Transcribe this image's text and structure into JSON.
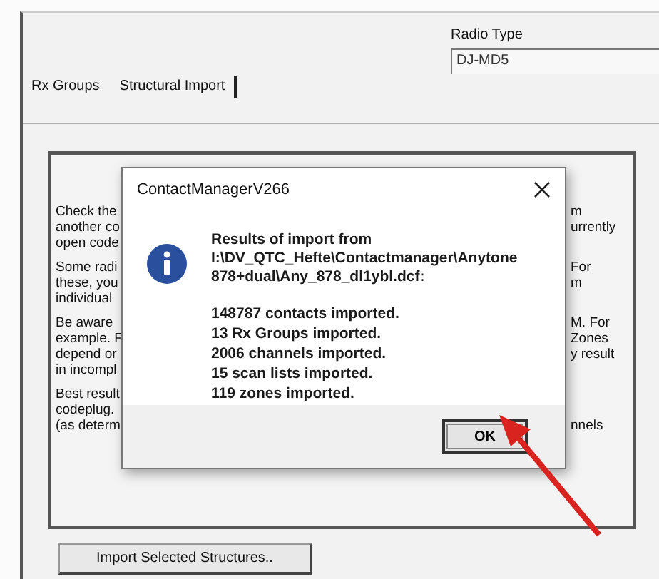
{
  "tabs": [
    {
      "label": "Rx Groups",
      "selected": false
    },
    {
      "label": "Structural Import",
      "selected": true
    }
  ],
  "radio_type": {
    "label": "Radio Type",
    "value": "DJ-MD5"
  },
  "paragraphs": [
    {
      "lines": [
        {
          "left": "Check the",
          "right": "m"
        },
        {
          "left": "another co",
          "right": "urrently"
        },
        {
          "left": "open code"
        }
      ]
    },
    {
      "lines": [
        {
          "left": "Some radi",
          "right": "For"
        },
        {
          "left": "these, you",
          "right": "m"
        },
        {
          "left": "individual"
        }
      ]
    },
    {
      "lines": [
        {
          "left": "Be aware",
          "right": "M. For"
        },
        {
          "left": "example. F",
          "right": "Zones"
        },
        {
          "left": "depend or",
          "right": "y result"
        },
        {
          "left": "in incompl"
        }
      ]
    },
    {
      "lines": [
        {
          "left": "Best result"
        },
        {
          "left": "codeplug."
        },
        {
          "left": "(as determ",
          "right": "nnels"
        }
      ]
    }
  ],
  "import_button": "Import Selected Structures..",
  "dialog": {
    "title": "ContactManagerV266",
    "message": [
      "Results of import from",
      "I:\\DV_QTC_Hefte\\Contactmanager\\Anytone",
      "878+dual\\Any_878_dl1ybl.dcf:"
    ],
    "results": [
      "148787 contacts imported.",
      "13 Rx Groups imported.",
      "2006 channels imported.",
      "15 scan lists imported.",
      "119 zones imported."
    ],
    "ok_button": "OK"
  }
}
